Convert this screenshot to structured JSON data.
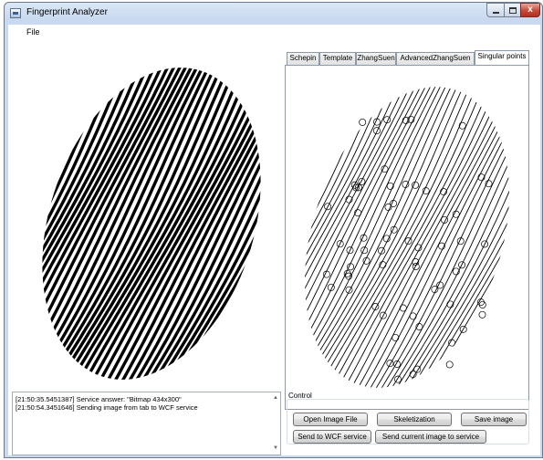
{
  "window": {
    "title": "Fingerprint Analyzer",
    "close_glyph": "x"
  },
  "menu": {
    "items": [
      "File"
    ]
  },
  "tabs": [
    "Schepin",
    "Template",
    "ZhangSuen",
    "AdvancedZhangSuen",
    "Singular points"
  ],
  "active_tab": "Singular points",
  "log": {
    "lines": [
      "[21:50:35.5451387] Service answer: \"Bitmap 434x300\"",
      "[21:50:54.3451646] Sending image from  tab to WCF service"
    ]
  },
  "control": {
    "label": "Control",
    "buttons": {
      "open": "Open Image File",
      "skeletize": "Skeletization",
      "save": "Save image",
      "send_wcf": "Send to WCF service",
      "send_current": "Send current image to service"
    }
  },
  "colors": {
    "ridge": "#000000",
    "titlebar": "#c9daf0",
    "close": "#c74a38"
  },
  "icons": [
    "app-icon",
    "minimize-icon",
    "maximize-icon",
    "close-icon",
    "scroll-up-icon",
    "scroll-down-icon"
  ]
}
